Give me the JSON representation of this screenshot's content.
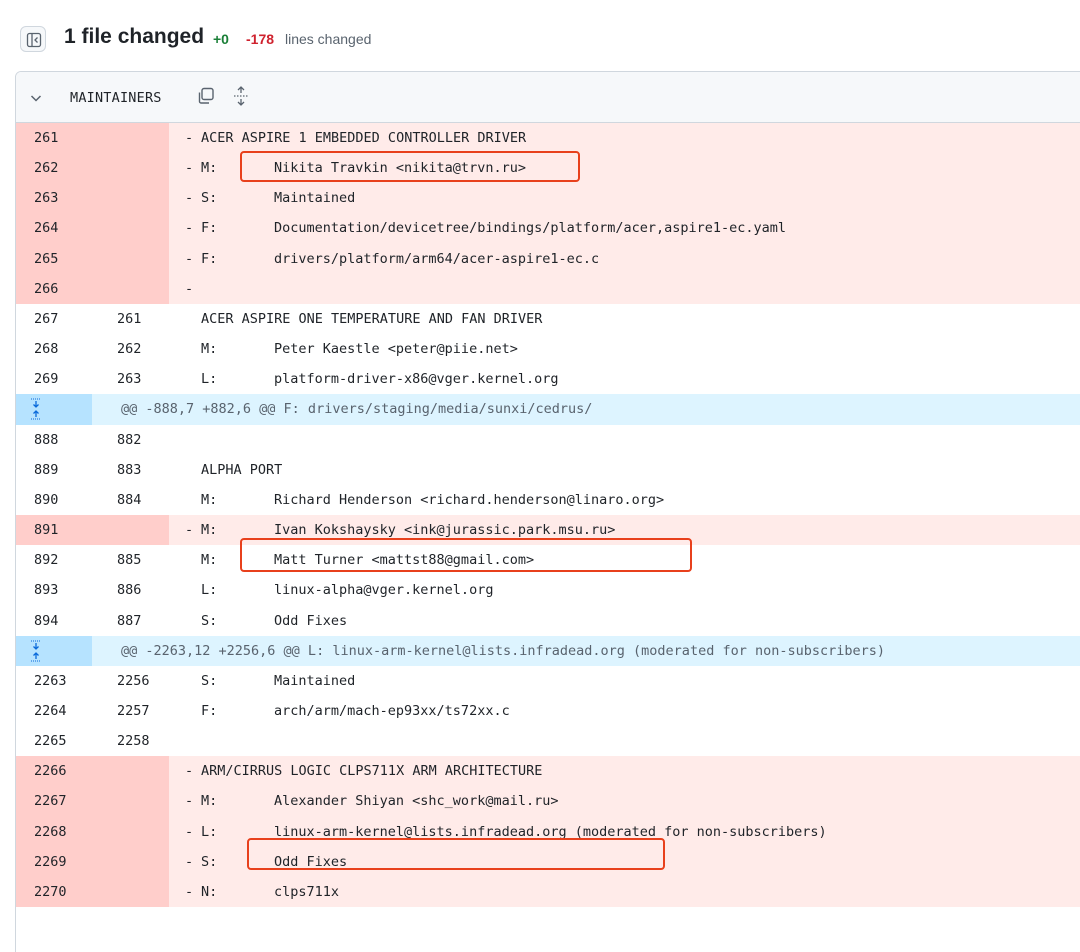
{
  "header": {
    "files_changed": "1 file changed",
    "additions": "+0",
    "deletions": "-178",
    "lines_changed": "lines changed"
  },
  "file": {
    "name": "MAINTAINERS"
  },
  "colors": {
    "deleted_line": "#ffebe9",
    "deleted_gutter": "#ffcecb",
    "hunk_bg": "#ddf4ff",
    "highlight": "#e8401c"
  },
  "rows": [
    {
      "type": "del",
      "old": "261",
      "new": "",
      "sign": "-",
      "key": "",
      "val": "",
      "heading": "ACER ASPIRE 1 EMBEDDED CONTROLLER DRIVER"
    },
    {
      "type": "del",
      "old": "262",
      "new": "",
      "sign": "-",
      "key": "M:",
      "val": "Nikita Travkin <nikita@trvn.ru>",
      "heading": ""
    },
    {
      "type": "del",
      "old": "263",
      "new": "",
      "sign": "-",
      "key": "S:",
      "val": "Maintained",
      "heading": ""
    },
    {
      "type": "del",
      "old": "264",
      "new": "",
      "sign": "-",
      "key": "F:",
      "val": "Documentation/devicetree/bindings/platform/acer,aspire1-ec.yaml",
      "heading": ""
    },
    {
      "type": "del",
      "old": "265",
      "new": "",
      "sign": "-",
      "key": "F:",
      "val": "drivers/platform/arm64/acer-aspire1-ec.c",
      "heading": ""
    },
    {
      "type": "del",
      "old": "266",
      "new": "",
      "sign": "-",
      "key": "",
      "val": "",
      "heading": ""
    },
    {
      "type": "ctx",
      "old": "267",
      "new": "261",
      "sign": "",
      "key": "",
      "val": "",
      "heading": "ACER ASPIRE ONE TEMPERATURE AND FAN DRIVER"
    },
    {
      "type": "ctx",
      "old": "268",
      "new": "262",
      "sign": "",
      "key": "M:",
      "val": "Peter Kaestle <peter@piie.net>",
      "heading": ""
    },
    {
      "type": "ctx",
      "old": "269",
      "new": "263",
      "sign": "",
      "key": "L:",
      "val": "platform-driver-x86@vger.kernel.org",
      "heading": ""
    },
    {
      "type": "hunk",
      "text": "@@ -888,7 +882,6 @@ F: drivers/staging/media/sunxi/cedrus/"
    },
    {
      "type": "ctx",
      "old": "888",
      "new": "882",
      "sign": "",
      "key": "",
      "val": "",
      "heading": ""
    },
    {
      "type": "ctx",
      "old": "889",
      "new": "883",
      "sign": "",
      "key": "",
      "val": "",
      "heading": "ALPHA PORT"
    },
    {
      "type": "ctx",
      "old": "890",
      "new": "884",
      "sign": "",
      "key": "M:",
      "val": "Richard Henderson <richard.henderson@linaro.org>",
      "heading": ""
    },
    {
      "type": "del",
      "old": "891",
      "new": "",
      "sign": "-",
      "key": "M:",
      "val": "Ivan Kokshaysky <ink@jurassic.park.msu.ru>",
      "heading": ""
    },
    {
      "type": "ctx",
      "old": "892",
      "new": "885",
      "sign": "",
      "key": "M:",
      "val": "Matt Turner <mattst88@gmail.com>",
      "heading": ""
    },
    {
      "type": "ctx",
      "old": "893",
      "new": "886",
      "sign": "",
      "key": "L:",
      "val": "linux-alpha@vger.kernel.org",
      "heading": ""
    },
    {
      "type": "ctx",
      "old": "894",
      "new": "887",
      "sign": "",
      "key": "S:",
      "val": "Odd Fixes",
      "heading": ""
    },
    {
      "type": "hunk",
      "text": "@@ -2263,12 +2256,6 @@ L: linux-arm-kernel@lists.infradead.org (moderated for non-subscribers)"
    },
    {
      "type": "ctx",
      "old": "2263",
      "new": "2256",
      "sign": "",
      "key": "S:",
      "val": "Maintained",
      "heading": ""
    },
    {
      "type": "ctx",
      "old": "2264",
      "new": "2257",
      "sign": "",
      "key": "F:",
      "val": "arch/arm/mach-ep93xx/ts72xx.c",
      "heading": ""
    },
    {
      "type": "ctx",
      "old": "2265",
      "new": "2258",
      "sign": "",
      "key": "",
      "val": "",
      "heading": ""
    },
    {
      "type": "del",
      "old": "2266",
      "new": "",
      "sign": "-",
      "key": "",
      "val": "",
      "heading": "ARM/CIRRUS LOGIC CLPS711X ARM ARCHITECTURE"
    },
    {
      "type": "del",
      "old": "2267",
      "new": "",
      "sign": "-",
      "key": "M:",
      "val": "Alexander Shiyan <shc_work@mail.ru>",
      "heading": ""
    },
    {
      "type": "del",
      "old": "2268",
      "new": "",
      "sign": "-",
      "key": "L:",
      "val": "linux-arm-kernel@lists.infradead.org (moderated for non-subscribers)",
      "heading": ""
    },
    {
      "type": "del",
      "old": "2269",
      "new": "",
      "sign": "-",
      "key": "S:",
      "val": "Odd Fixes",
      "heading": ""
    },
    {
      "type": "del",
      "old": "2270",
      "new": "",
      "sign": "-",
      "key": "N:",
      "val": "clps711x",
      "heading": ""
    }
  ]
}
